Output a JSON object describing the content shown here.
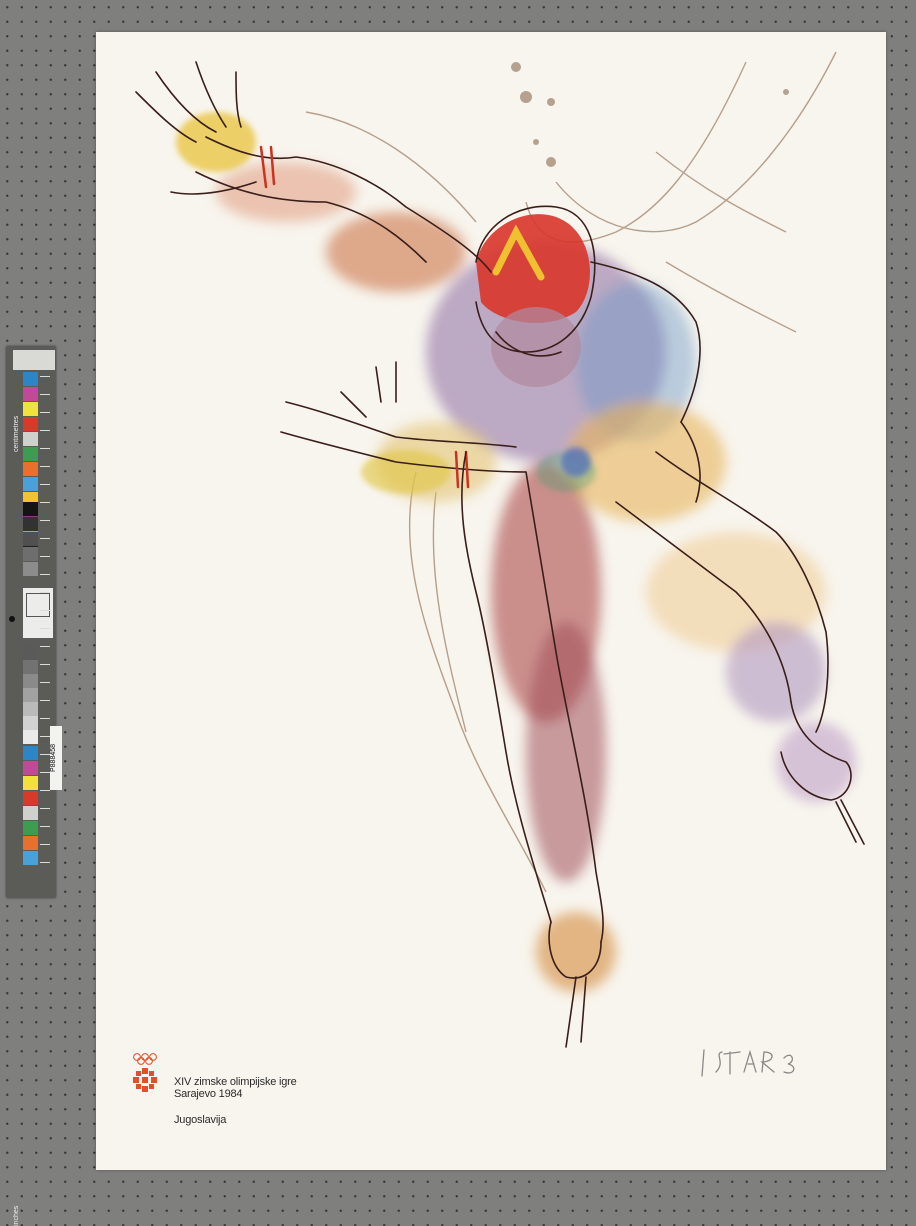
{
  "poster": {
    "event_line": "XIV zimske olimpijske igre",
    "city_year": "Sarajevo 1984",
    "country": "Jugoslavija",
    "signature": "ISTAR 83"
  },
  "calibration_target": {
    "id": "P888458",
    "brand_label": "centimetres",
    "lower_label": "inches",
    "colors": [
      "#2a86c8",
      "#c04a96",
      "#f0e23a",
      "#d83a2a",
      "#d0d0cc",
      "#3c9c50",
      "#e8702c",
      "#4aa0d8",
      "#f2c42a",
      "#8a3a8c",
      "#8ec040",
      "#202020"
    ]
  },
  "artwork": {
    "subject": "speed-skater-painting",
    "palette": [
      "#c23a2c",
      "#e8b43a",
      "#7a5aa0",
      "#d98a3a",
      "#6a90c0",
      "#3b2220"
    ]
  }
}
